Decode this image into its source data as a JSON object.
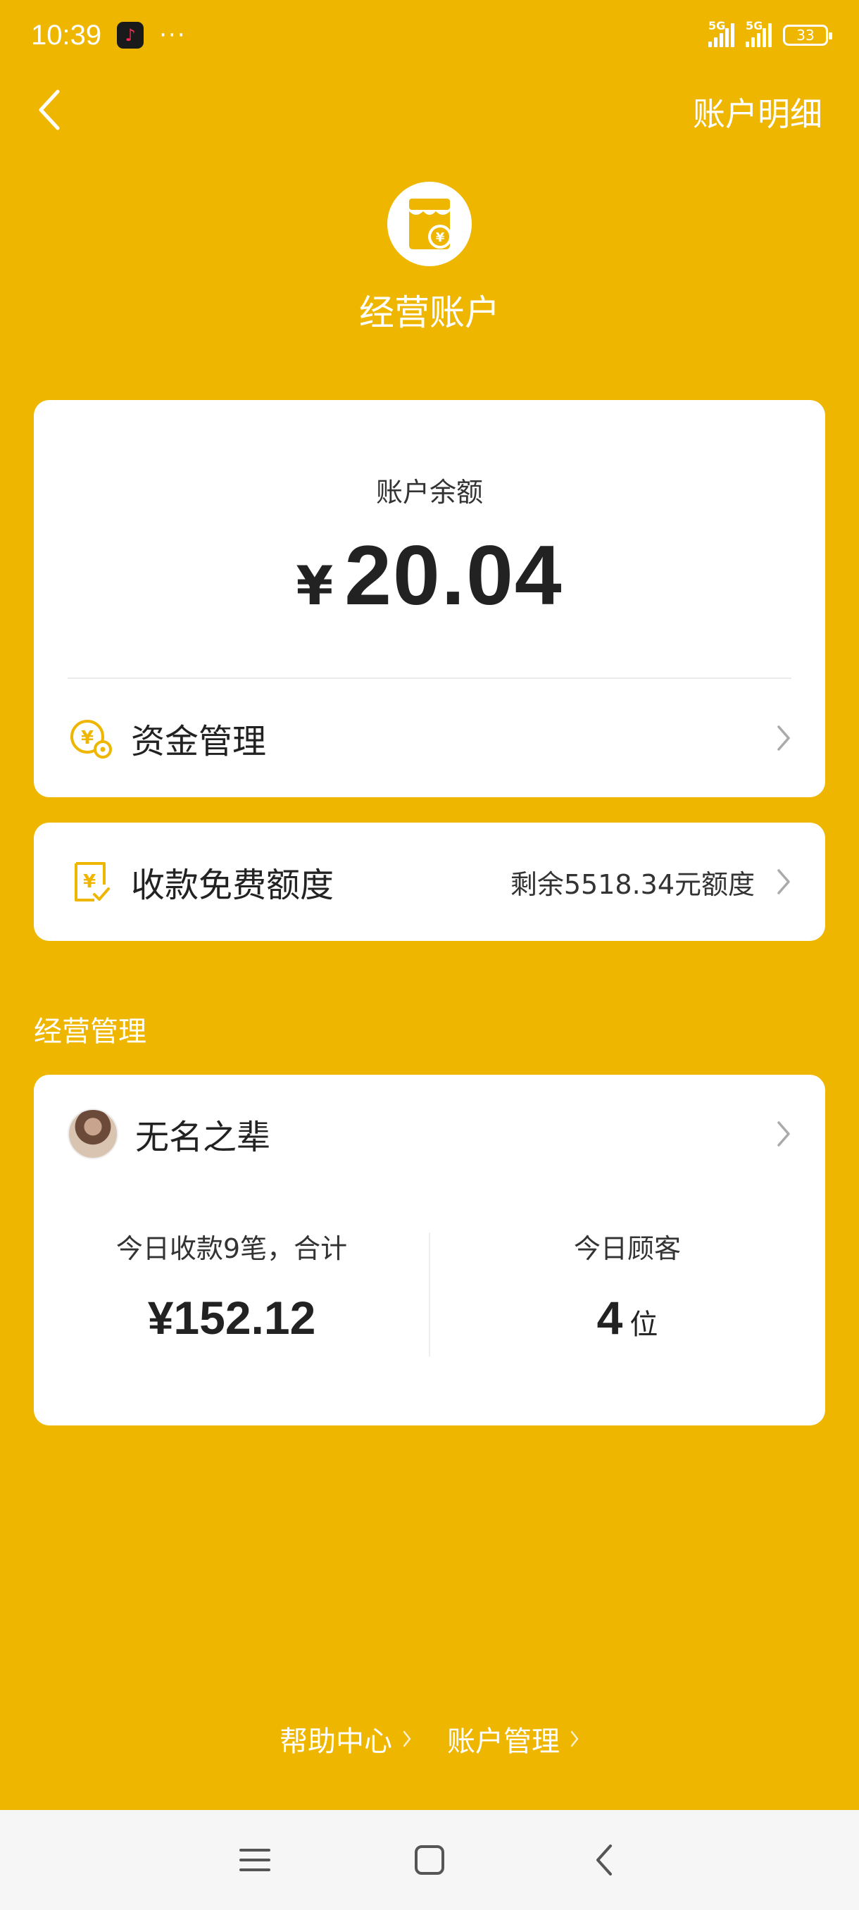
{
  "status_bar": {
    "time": "10:39",
    "dots": "···",
    "network_1": "5G",
    "network_2": "5G",
    "battery": "33"
  },
  "nav": {
    "back_icon": "back-arrow-icon",
    "detail_link": "账户明细"
  },
  "header": {
    "icon": "store-yuan-icon",
    "title": "经营账户"
  },
  "balance_card": {
    "label": "账户余额",
    "currency": "¥",
    "amount": "20.04",
    "fund_management": {
      "icon": "yuan-gear-icon",
      "label": "资金管理"
    }
  },
  "free_quota": {
    "icon": "receipt-yuan-icon",
    "label": "收款免费额度",
    "value": "剩余5518.34元额度"
  },
  "section_title": "经营管理",
  "store": {
    "name": "无名之辈",
    "stats": {
      "today_receipts_label": "今日收款9笔，合计",
      "today_receipts_value": "¥152.12",
      "today_customers_label": "今日顾客",
      "today_customers_value": "4",
      "today_customers_unit": "位"
    }
  },
  "footer": {
    "help_center": "帮助中心",
    "account_management": "账户管理"
  },
  "colors": {
    "background": "#EFB600",
    "card": "#FFFFFF",
    "accent": "#EFB600"
  }
}
